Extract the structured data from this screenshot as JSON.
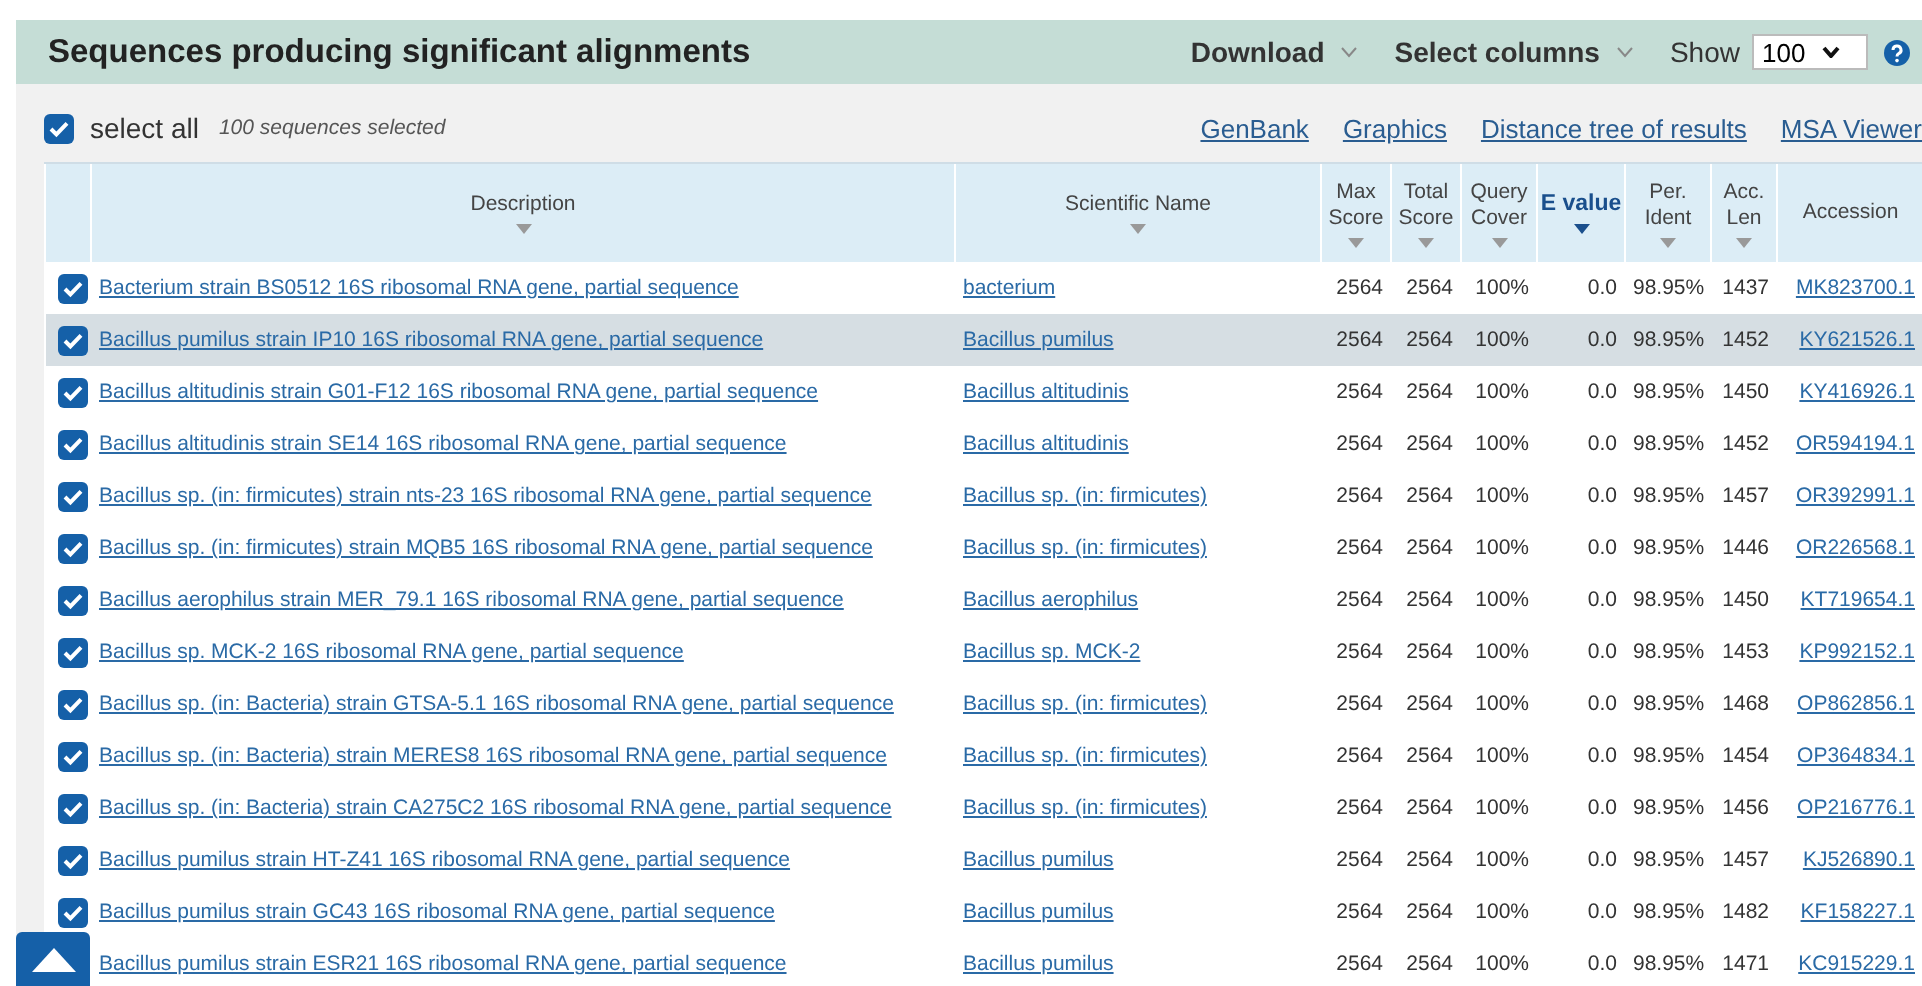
{
  "header": {
    "title": "Sequences producing significant alignments",
    "menus": [
      {
        "label": "Download"
      },
      {
        "label": "Select columns"
      }
    ],
    "show_label": "Show",
    "show_value": "100"
  },
  "toolbar": {
    "select_all": {
      "label": "select all",
      "checked": true
    },
    "selected_count": "100 sequences selected",
    "links": [
      "GenBank",
      "Graphics",
      "Distance tree of results",
      "MSA Viewer"
    ]
  },
  "table": {
    "columns": [
      {
        "label": "Description",
        "sorted": false
      },
      {
        "label": "Scientific Name",
        "sorted": false
      },
      {
        "label": "Max Score",
        "sorted": false
      },
      {
        "label": "Total Score",
        "sorted": false
      },
      {
        "label": "Query Cover",
        "sorted": false
      },
      {
        "label": "E value",
        "sorted": true
      },
      {
        "label": "Per. Ident",
        "sorted": false
      },
      {
        "label": "Acc. Len",
        "sorted": false
      },
      {
        "label": "Accession"
      }
    ],
    "rows": [
      {
        "checked": true,
        "selected": false,
        "cells": [
          "Bacterium strain BS0512 16S ribosomal RNA gene, partial sequence",
          "bacterium",
          "2564",
          "2564",
          "100%",
          "0.0",
          "98.95%",
          "1437",
          "MK823700.1"
        ]
      },
      {
        "checked": true,
        "selected": true,
        "cells": [
          "Bacillus pumilus strain IP10 16S ribosomal RNA gene, partial sequence",
          "Bacillus pumilus",
          "2564",
          "2564",
          "100%",
          "0.0",
          "98.95%",
          "1452",
          "KY621526.1"
        ]
      },
      {
        "checked": true,
        "selected": false,
        "cells": [
          "Bacillus altitudinis strain G01-F12 16S ribosomal RNA gene, partial sequence",
          "Bacillus altitudinis",
          "2564",
          "2564",
          "100%",
          "0.0",
          "98.95%",
          "1450",
          "KY416926.1"
        ]
      },
      {
        "checked": true,
        "selected": false,
        "cells": [
          "Bacillus altitudinis strain SE14 16S ribosomal RNA gene, partial sequence",
          "Bacillus altitudinis",
          "2564",
          "2564",
          "100%",
          "0.0",
          "98.95%",
          "1452",
          "OR594194.1"
        ]
      },
      {
        "checked": true,
        "selected": false,
        "cells": [
          "Bacillus sp. (in: firmicutes) strain nts-23 16S ribosomal RNA gene, partial sequence",
          "Bacillus sp. (in: firmicutes)",
          "2564",
          "2564",
          "100%",
          "0.0",
          "98.95%",
          "1457",
          "OR392991.1"
        ]
      },
      {
        "checked": true,
        "selected": false,
        "cells": [
          "Bacillus sp. (in: firmicutes) strain MQB5 16S ribosomal RNA gene, partial sequence",
          "Bacillus sp. (in: firmicutes)",
          "2564",
          "2564",
          "100%",
          "0.0",
          "98.95%",
          "1446",
          "OR226568.1"
        ]
      },
      {
        "checked": true,
        "selected": false,
        "cells": [
          "Bacillus aerophilus strain MER_79.1 16S ribosomal RNA gene, partial sequence",
          "Bacillus aerophilus",
          "2564",
          "2564",
          "100%",
          "0.0",
          "98.95%",
          "1450",
          "KT719654.1"
        ]
      },
      {
        "checked": true,
        "selected": false,
        "cells": [
          "Bacillus sp. MCK-2 16S ribosomal RNA gene, partial sequence",
          "Bacillus sp. MCK-2",
          "2564",
          "2564",
          "100%",
          "0.0",
          "98.95%",
          "1453",
          "KP992152.1"
        ]
      },
      {
        "checked": true,
        "selected": false,
        "cells": [
          "Bacillus sp. (in: Bacteria) strain GTSA-5.1 16S ribosomal RNA gene, partial sequence",
          "Bacillus sp. (in: firmicutes)",
          "2564",
          "2564",
          "100%",
          "0.0",
          "98.95%",
          "1468",
          "OP862856.1"
        ]
      },
      {
        "checked": true,
        "selected": false,
        "cells": [
          "Bacillus sp. (in: Bacteria) strain MERES8 16S ribosomal RNA gene, partial sequence",
          "Bacillus sp. (in: firmicutes)",
          "2564",
          "2564",
          "100%",
          "0.0",
          "98.95%",
          "1454",
          "OP364834.1"
        ]
      },
      {
        "checked": true,
        "selected": false,
        "cells": [
          "Bacillus sp. (in: Bacteria) strain CA275C2 16S ribosomal RNA gene, partial sequence",
          "Bacillus sp. (in: firmicutes)",
          "2564",
          "2564",
          "100%",
          "0.0",
          "98.95%",
          "1456",
          "OP216776.1"
        ]
      },
      {
        "checked": true,
        "selected": false,
        "cells": [
          "Bacillus pumilus strain HT-Z41 16S ribosomal RNA gene, partial sequence",
          "Bacillus pumilus",
          "2564",
          "2564",
          "100%",
          "0.0",
          "98.95%",
          "1457",
          "KJ526890.1"
        ]
      },
      {
        "checked": true,
        "selected": false,
        "cells": [
          "Bacillus pumilus strain GC43 16S ribosomal RNA gene, partial sequence",
          "Bacillus pumilus",
          "2564",
          "2564",
          "100%",
          "0.0",
          "98.95%",
          "1482",
          "KF158227.1"
        ]
      },
      {
        "selected": false,
        "cells": [
          "Bacillus pumilus strain ESR21 16S ribosomal RNA gene, partial sequence",
          "Bacillus pumilus",
          "2564",
          "2564",
          "100%",
          "0.0",
          "98.95%",
          "1471",
          "KC915229.1"
        ]
      }
    ]
  }
}
